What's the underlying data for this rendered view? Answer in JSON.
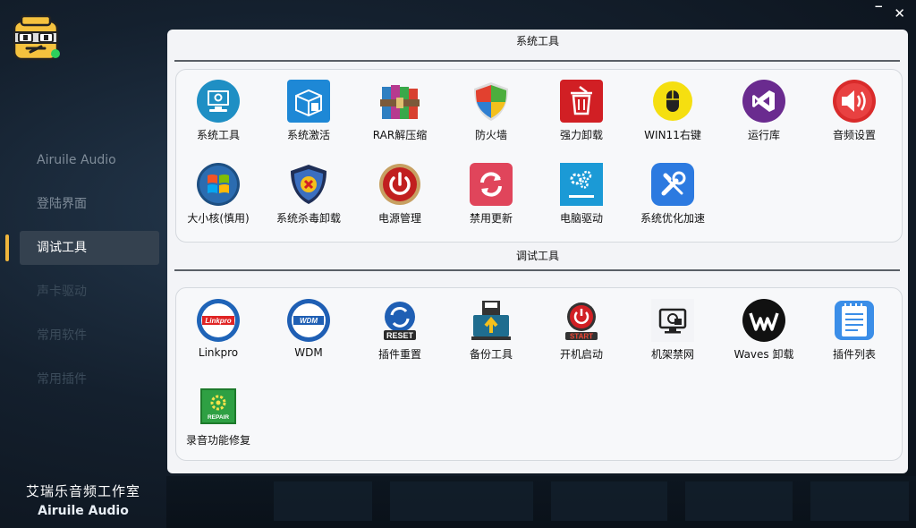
{
  "window": {
    "minimize_glyph": "‾",
    "close_glyph": "✕"
  },
  "sidebar": {
    "items": [
      {
        "label": "Airuile Audio",
        "state": "normal"
      },
      {
        "label": "登陆界面",
        "state": "normal"
      },
      {
        "label": "调试工具",
        "state": "active"
      },
      {
        "label": "声卡驱动",
        "state": "dim"
      },
      {
        "label": "常用软件",
        "state": "dim"
      },
      {
        "label": "常用插件",
        "state": "dim"
      }
    ]
  },
  "brand": {
    "name_cn": "艾瑞乐音频工作室",
    "name_en": "Airuile Audio"
  },
  "sections": [
    {
      "title": "系统工具",
      "tools": [
        {
          "label": "系统工具",
          "icon": "system-tools-icon"
        },
        {
          "label": "系统激活",
          "icon": "windows-activation-icon"
        },
        {
          "label": "RAR解压缩",
          "icon": "winrar-icon"
        },
        {
          "label": "防火墙",
          "icon": "firewall-shield-icon"
        },
        {
          "label": "强力卸载",
          "icon": "uninstall-trash-icon"
        },
        {
          "label": "WIN11右键",
          "icon": "mouse-icon"
        },
        {
          "label": "运行库",
          "icon": "visual-studio-icon"
        },
        {
          "label": "音频设置",
          "icon": "speaker-icon"
        },
        {
          "label": "大小核(慎用)",
          "icon": "windows-orb-icon"
        },
        {
          "label": "系统杀毒卸载",
          "icon": "antivirus-shield-icon"
        },
        {
          "label": "电源管理",
          "icon": "power-icon"
        },
        {
          "label": "禁用更新",
          "icon": "update-refresh-icon"
        },
        {
          "label": "电脑驱动",
          "icon": "driver-gears-icon"
        },
        {
          "label": "系统优化加速",
          "icon": "optimize-tools-icon"
        }
      ]
    },
    {
      "title": "调试工具",
      "tools": [
        {
          "label": "Linkpro",
          "icon": "linkpro-icon"
        },
        {
          "label": "WDM",
          "icon": "wdm-icon"
        },
        {
          "label": "插件重置",
          "icon": "reset-icon"
        },
        {
          "label": "备份工具",
          "icon": "backup-icon"
        },
        {
          "label": "开机启动",
          "icon": "start-power-icon"
        },
        {
          "label": "机架禁网",
          "icon": "network-lock-icon"
        },
        {
          "label": "Waves 卸载",
          "icon": "waves-icon"
        },
        {
          "label": "插件列表",
          "icon": "notepad-list-icon"
        },
        {
          "label": "录音功能修复",
          "icon": "repair-icon"
        }
      ]
    }
  ],
  "icon_text": {
    "linkpro": "Linkpro",
    "wdm": "WDM",
    "reset": "RESET",
    "start": "START",
    "repair": "REPAIR"
  },
  "colors": {
    "active_indicator": "#f0b63c",
    "panel_bg": "#f3f4f7",
    "divider": "#5a5f66"
  }
}
